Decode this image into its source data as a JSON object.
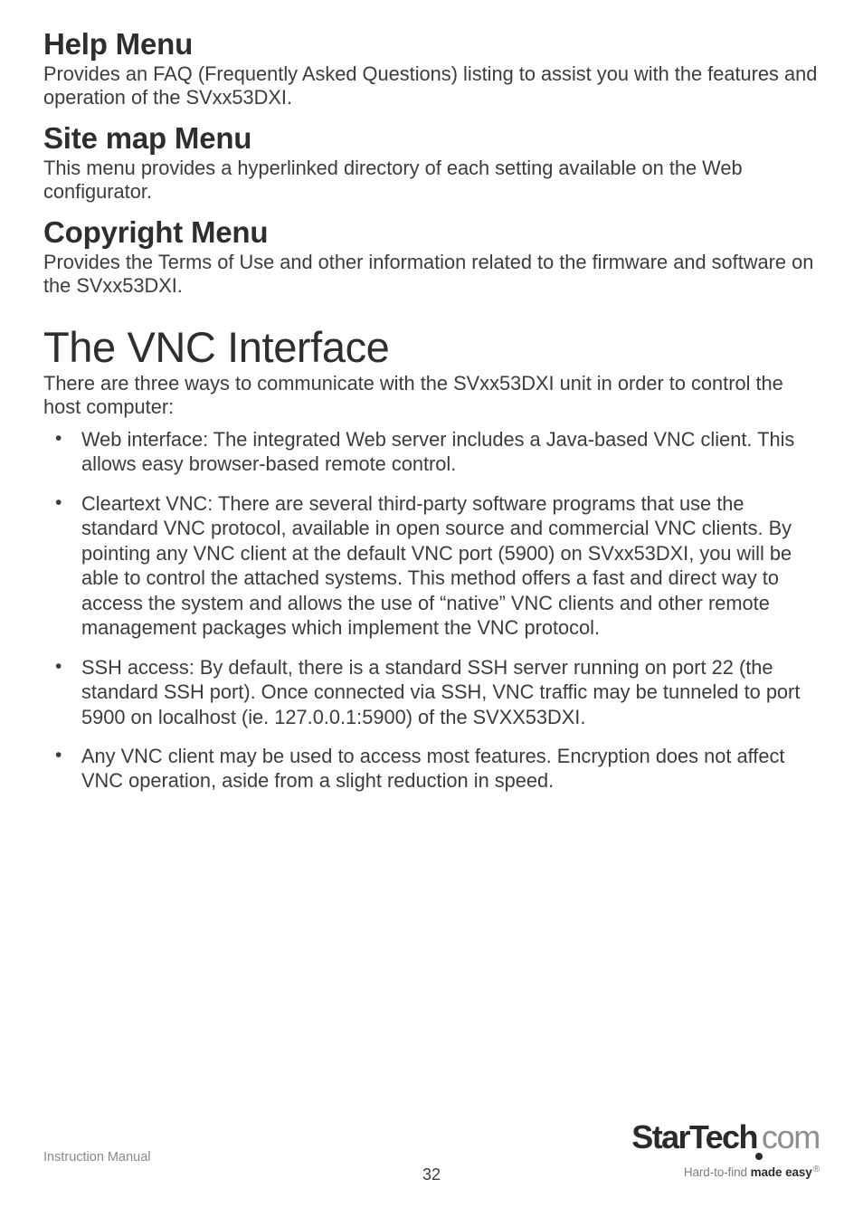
{
  "sections": {
    "help": {
      "h": "Help Menu",
      "p": "Provides an FAQ (Frequently Asked Questions) listing to assist you with the features and operation of the SVxx53DXI."
    },
    "sitemap": {
      "h": "Site map Menu",
      "p": "This menu provides a hyperlinked directory of each setting available on the Web configurator."
    },
    "copyright": {
      "h": "Copyright Menu",
      "p": "Provides the Terms of Use and other information related to the firmware and software on the SVxx53DXI."
    }
  },
  "h1": "The VNC Interface",
  "intro": "There are three ways to communicate with the SVxx53DXI unit in order to control the host computer:",
  "bullets": [
    "Web interface: The integrated Web server includes a Java-based VNC client. This allows easy browser-based remote control.",
    "Cleartext VNC:  There are several third-party software programs that use the standard VNC protocol, available in open source and commercial VNC clients.  By pointing any VNC client at the default VNC port (5900) on SVxx53DXI, you will be able to control the attached systems.  This method offers a fast and direct way to access the system and allows the use of “native” VNC clients and other remote management packages which implement the VNC protocol.",
    "SSH access: By default, there is a standard SSH server running on port 22 (the standard SSH port). Once connected via SSH, VNC traffic may be tunneled to port 5900 on localhost (ie. 127.0.0.1:5900) of the SVXX53DXI.",
    "Any VNC client may be used to access most features.  Encryption does not affect VNC operation, aside from a slight reduction in speed."
  ],
  "footer": {
    "label": "Instruction Manual",
    "page": "32",
    "logo_bold": "StarTech",
    "logo_thin": "com",
    "tag_pre": "Hard-to-find ",
    "tag_bold": "made easy",
    "tag_reg": "®"
  }
}
